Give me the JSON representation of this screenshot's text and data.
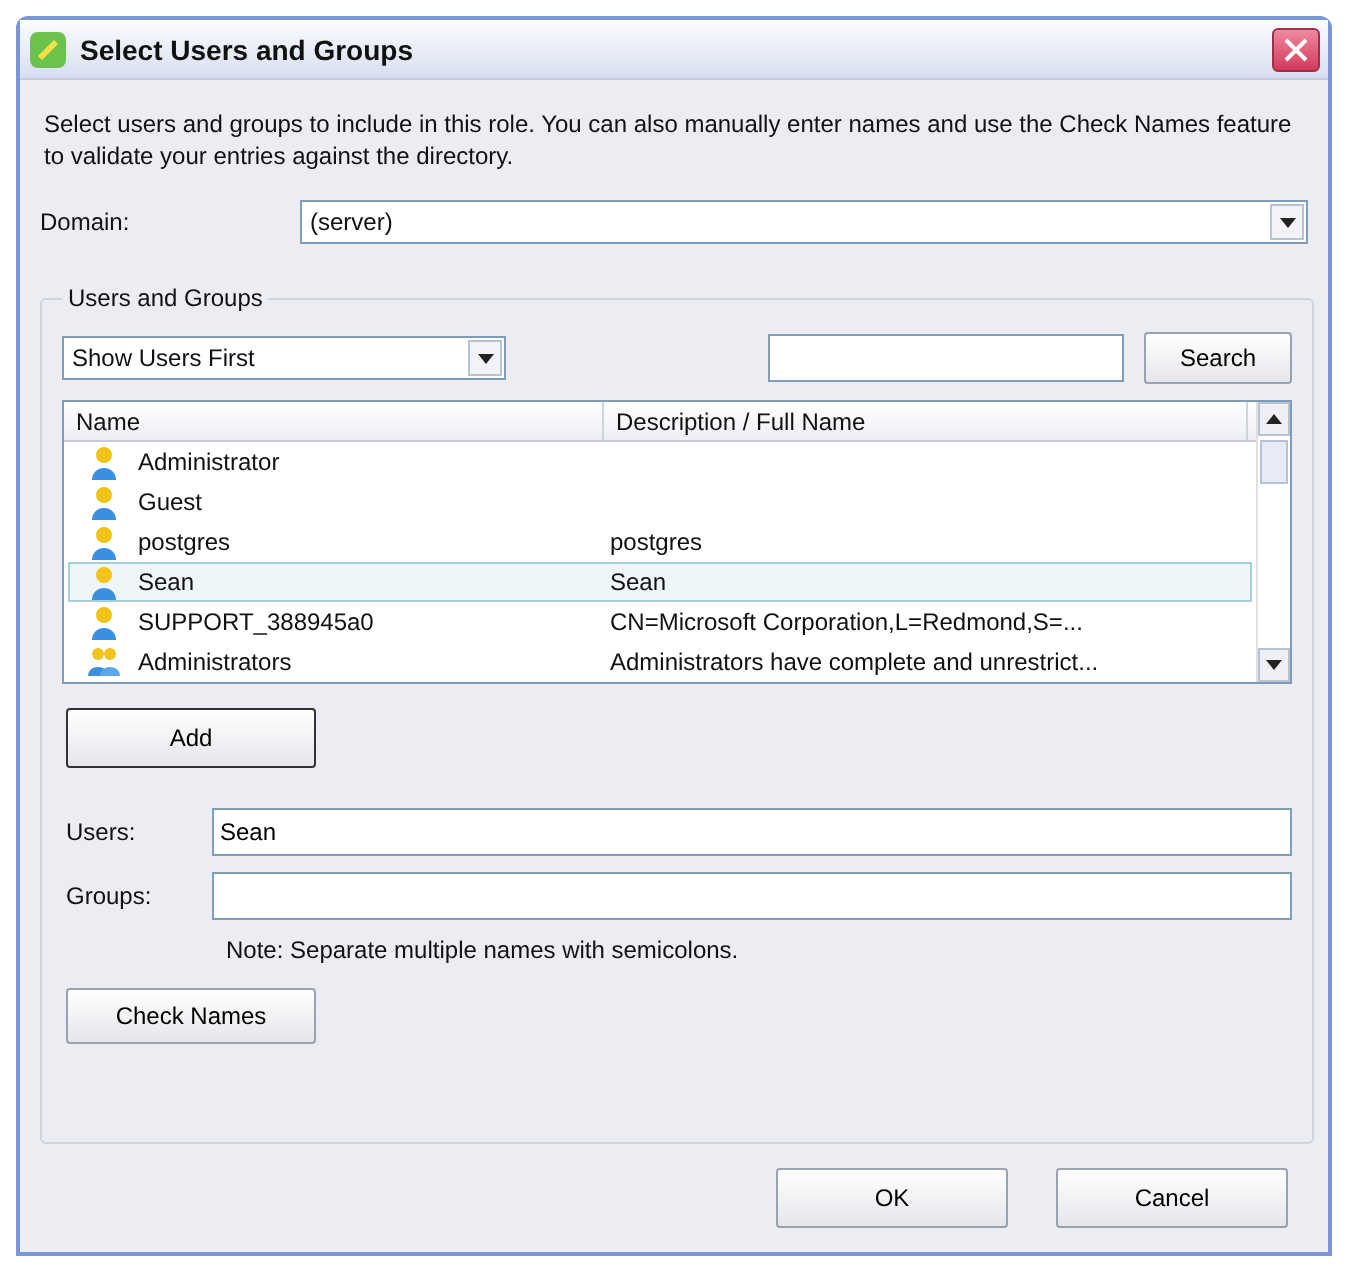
{
  "window": {
    "title": "Select Users and Groups"
  },
  "instructions": "Select users and groups to include in this role. You can also manually enter names and use the Check Names feature to validate your entries against the directory.",
  "domain": {
    "label": "Domain:",
    "value": "(server)"
  },
  "users_and_groups": {
    "legend": "Users and Groups",
    "filter": "Show Users First",
    "search_button": "Search",
    "columns": [
      "Name",
      "Description / Full Name"
    ],
    "rows": [
      {
        "kind": "user",
        "name": "Administrator",
        "description": "",
        "selected": false
      },
      {
        "kind": "user",
        "name": "Guest",
        "description": "",
        "selected": false
      },
      {
        "kind": "user",
        "name": "postgres",
        "description": "postgres",
        "selected": false
      },
      {
        "kind": "user",
        "name": "Sean",
        "description": "Sean",
        "selected": true
      },
      {
        "kind": "user",
        "name": "SUPPORT_388945a0",
        "description": "CN=Microsoft Corporation,L=Redmond,S=...",
        "selected": false
      },
      {
        "kind": "group",
        "name": "Administrators",
        "description": "Administrators have complete and unrestrict...",
        "selected": false
      }
    ],
    "add_button": "Add",
    "users": {
      "label": "Users:",
      "value": "Sean"
    },
    "groups": {
      "label": "Groups:"
    },
    "note": "Note: Separate multiple names with semicolons.",
    "check_names_button": "Check Names"
  },
  "buttons": [
    "OK",
    "Cancel"
  ]
}
